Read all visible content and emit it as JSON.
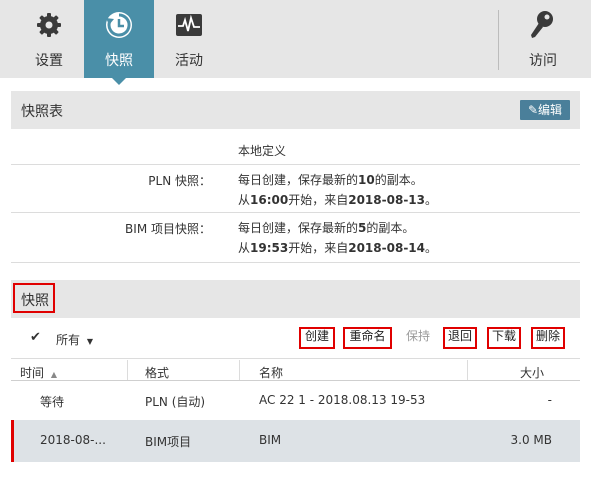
{
  "tabs": [
    {
      "label": "设置",
      "icon": "gear-icon"
    },
    {
      "label": "快照",
      "icon": "snapshot-icon"
    },
    {
      "label": "活动",
      "icon": "activity-icon"
    },
    {
      "label": "访问",
      "icon": "key-icon"
    }
  ],
  "snapshot_table": {
    "title": "快照表",
    "edit_label": "编辑",
    "local_definition": "本地定义",
    "pln_label": "PLN 快照：",
    "pln_line1_a": "每日创建，保存最新的",
    "pln_count": "10",
    "pln_line1_b": "的副本。",
    "pln_line2_a": "从",
    "pln_time": "16:00",
    "pln_line2_b": "开始，来自",
    "pln_date": "2018-08-13",
    "pln_line2_c": "。",
    "bim_label": "BIM 项目快照：",
    "bim_line1_a": "每日创建，保存最新的",
    "bim_count": "5",
    "bim_line1_b": "的副本。",
    "bim_line2_a": "从",
    "bim_time": "19:53",
    "bim_line2_b": "开始，来自",
    "bim_date": "2018-08-14",
    "bim_line2_c": "。"
  },
  "snapshots": {
    "title": "快照",
    "filter_label": "所有",
    "actions": {
      "create": "创建",
      "rename": "重命名",
      "keep": "保持",
      "revert": "退回",
      "download": "下载",
      "delete": "删除"
    },
    "columns": {
      "time": "时间",
      "format": "格式",
      "name": "名称",
      "size": "大小"
    },
    "rows": [
      {
        "time": "等待",
        "format": "PLN (自动)",
        "name": "AC 22 1 - 2018.08.13 19-53",
        "size": "-"
      },
      {
        "time": "2018-08-...",
        "format": "BIM项目",
        "name": "BIM",
        "size": "3.0 MB"
      }
    ]
  },
  "colors": {
    "accent": "#4a8fa8",
    "header_bg": "#e6e6e6",
    "highlight_box": "#e00000",
    "selected_row_bg": "#dde2e6"
  }
}
